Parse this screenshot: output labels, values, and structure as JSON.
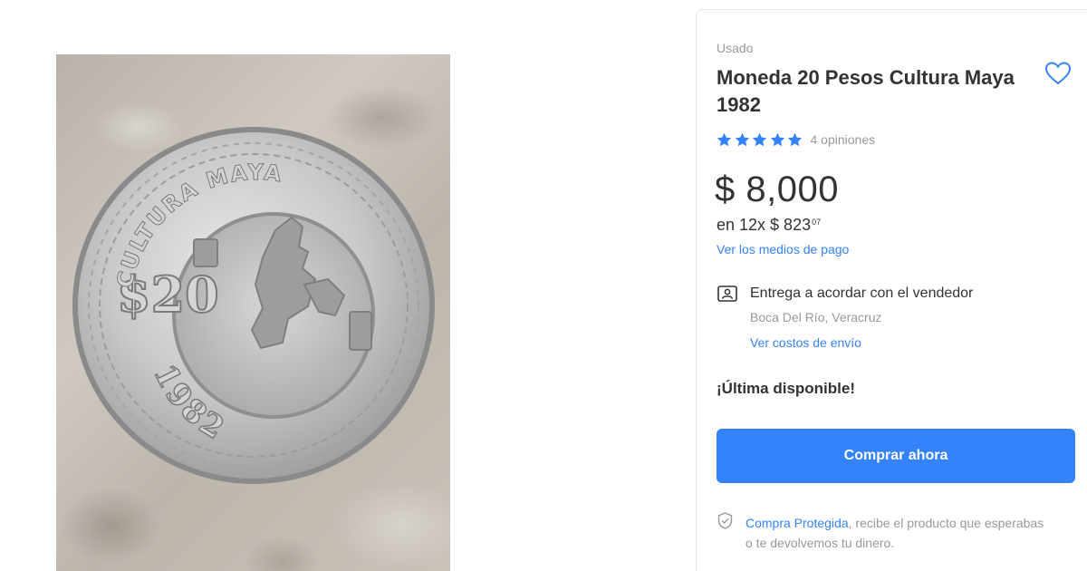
{
  "product": {
    "condition": "Usado",
    "title": "Moneda 20 Pesos Cultura Maya 1982",
    "image_alt": "Moneda 20 Pesos Cultura Maya 1982"
  },
  "coin_image": {
    "denomination": "$20",
    "legend": "CULTURA MAYA",
    "year": "1982"
  },
  "rating": {
    "stars": 5,
    "star_color": "#3483fa",
    "reviews_label": "4 opiniones"
  },
  "pricing": {
    "price": "$ 8,000",
    "installments_prefix": "en 12x $ 823",
    "installments_cents": "07",
    "payment_methods_link": "Ver los medios de pago"
  },
  "shipping": {
    "icon": "seller-meeting-icon",
    "label": "Entrega a acordar con el vendedor",
    "location": "Boca Del Río, Veracruz",
    "costs_link": "Ver costos de envío"
  },
  "stock": {
    "label": "¡Última disponible!"
  },
  "actions": {
    "buy_label": "Comprar ahora",
    "favorite_icon": "heart-icon"
  },
  "protection": {
    "icon": "shield-icon",
    "link": "Compra Protegida",
    "text": ", recibe el producto que esperabas o te devolvemos tu dinero."
  },
  "colors": {
    "accent": "#3483fa",
    "text": "#333333",
    "muted": "#999999"
  }
}
